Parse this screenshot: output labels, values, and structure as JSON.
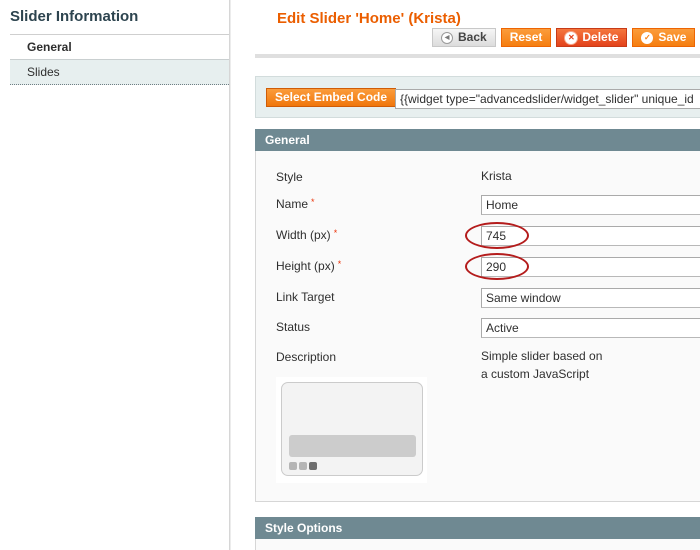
{
  "sidebar": {
    "title": "Slider Information",
    "tabs": [
      {
        "label": "General",
        "active": true
      },
      {
        "label": "Slides",
        "active": false
      }
    ]
  },
  "header": {
    "title": "Edit Slider 'Home' (Krista)",
    "buttons": {
      "back": "Back",
      "reset": "Reset",
      "delete": "Delete",
      "save": "Save"
    }
  },
  "embed": {
    "button_label": "Select Embed Code",
    "code_value": "{{widget type=\"advancedslider/widget_slider\" unique_id"
  },
  "general": {
    "section_title": "General",
    "fields": {
      "style": {
        "label": "Style",
        "value": "Krista"
      },
      "name": {
        "label": "Name",
        "required": "*",
        "value": "Home"
      },
      "width": {
        "label": "Width (px)",
        "required": "*",
        "value": "745"
      },
      "height": {
        "label": "Height (px)",
        "required": "*",
        "value": "290"
      },
      "link_target": {
        "label": "Link Target",
        "value": "Same window"
      },
      "status": {
        "label": "Status",
        "value": "Active"
      },
      "description": {
        "label": "Description",
        "line1": "Simple slider based on",
        "line2": "a custom JavaScript"
      }
    }
  },
  "style_options": {
    "section_title": "Style Options"
  },
  "colors": {
    "accent": "#eb5e00",
    "section_header": "#6f8992",
    "annotation_circle": "#b41c1c"
  }
}
